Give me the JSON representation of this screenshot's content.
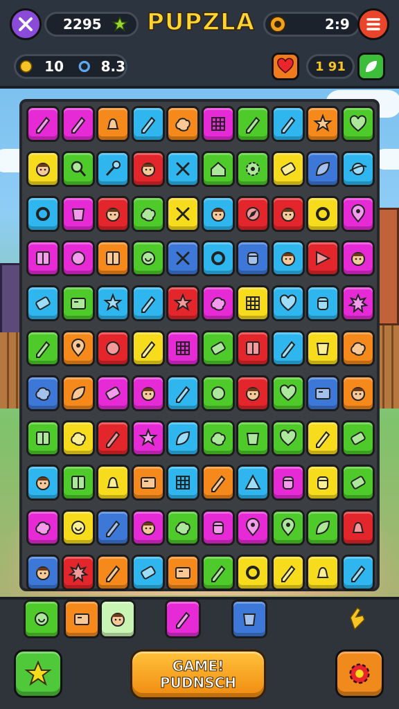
{
  "header": {
    "title": "PUPZLA",
    "score": "2295",
    "timer_value": "2:9",
    "coins": "10",
    "gems": "8.3",
    "energy": "1 91"
  },
  "colors": {
    "magenta": "#e62bd6",
    "orange": "#f5891c",
    "yellow": "#f7dc1e",
    "cyan": "#2fb6ef",
    "green": "#4ecb2a",
    "red": "#e3262b",
    "blue": "#3d78d8",
    "purple": "#a45be6"
  },
  "board": {
    "rows": [
      [
        [
          "magenta",
          "pencil-icon"
        ],
        [
          "magenta",
          "pencil-icon"
        ],
        [
          "orange",
          "bell-icon"
        ],
        [
          "cyan",
          "pencil-icon"
        ],
        [
          "orange",
          "blob-icon"
        ],
        [
          "magenta",
          "grid-icon"
        ],
        [
          "green",
          "pencil-icon"
        ],
        [
          "cyan",
          "pencil-icon"
        ],
        [
          "orange",
          "star-icon"
        ],
        [
          "green",
          "heart-icon"
        ]
      ],
      [
        [
          "yellow",
          "face-icon"
        ],
        [
          "green",
          "magnifier-icon"
        ],
        [
          "cyan",
          "key-icon"
        ],
        [
          "red",
          "face-icon"
        ],
        [
          "cyan",
          "cross-icon"
        ],
        [
          "green",
          "house-icon"
        ],
        [
          "green",
          "gear-icon"
        ],
        [
          "yellow",
          "scroll-icon"
        ],
        [
          "blue",
          "leaf-icon"
        ],
        [
          "cyan",
          "planet-icon"
        ]
      ],
      [
        [
          "cyan",
          "ring-icon"
        ],
        [
          "magenta",
          "cup-icon"
        ],
        [
          "red",
          "face-icon"
        ],
        [
          "green",
          "blob-icon"
        ],
        [
          "yellow",
          "cross-icon"
        ],
        [
          "cyan",
          "face-icon"
        ],
        [
          "red",
          "compass-icon"
        ],
        [
          "red",
          "face-icon"
        ],
        [
          "yellow",
          "ring-icon"
        ],
        [
          "magenta",
          "pin-icon"
        ]
      ],
      [
        [
          "magenta",
          "box-icon"
        ],
        [
          "magenta",
          "circle-icon"
        ],
        [
          "orange",
          "box-icon"
        ],
        [
          "green",
          "shell-icon"
        ],
        [
          "blue",
          "cross-icon"
        ],
        [
          "cyan",
          "ring-icon"
        ],
        [
          "blue",
          "jar-icon"
        ],
        [
          "cyan",
          "face-icon"
        ],
        [
          "red",
          "flag-icon"
        ],
        [
          "magenta",
          "face-icon"
        ]
      ],
      [
        [
          "cyan",
          "scroll-icon"
        ],
        [
          "green",
          "card-icon"
        ],
        [
          "cyan",
          "star-icon"
        ],
        [
          "cyan",
          "pencil-icon"
        ],
        [
          "red",
          "star-icon"
        ],
        [
          "magenta",
          "blob-icon"
        ],
        [
          "yellow",
          "grid-icon"
        ],
        [
          "cyan",
          "heart-icon"
        ],
        [
          "cyan",
          "jar-icon"
        ],
        [
          "magenta",
          "burst-icon"
        ]
      ],
      [
        [
          "green",
          "pencil-icon"
        ],
        [
          "orange",
          "pin-icon"
        ],
        [
          "red",
          "circle-icon"
        ],
        [
          "yellow",
          "pencil-icon"
        ],
        [
          "magenta",
          "grid-icon"
        ],
        [
          "green",
          "scroll-icon"
        ],
        [
          "red",
          "box-icon"
        ],
        [
          "cyan",
          "pencil-icon"
        ],
        [
          "yellow",
          "cup-icon"
        ],
        [
          "orange",
          "blob-icon"
        ]
      ],
      [
        [
          "blue",
          "blob-icon"
        ],
        [
          "orange",
          "leaf-icon"
        ],
        [
          "magenta",
          "scroll-icon"
        ],
        [
          "magenta",
          "face-icon"
        ],
        [
          "cyan",
          "pencil-icon"
        ],
        [
          "green",
          "circle-icon"
        ],
        [
          "red",
          "face-icon"
        ],
        [
          "green",
          "heart-icon"
        ],
        [
          "blue",
          "card-icon"
        ],
        [
          "orange",
          "face-icon"
        ]
      ],
      [
        [
          "green",
          "box-icon"
        ],
        [
          "yellow",
          "blob-icon"
        ],
        [
          "red",
          "pencil-icon"
        ],
        [
          "magenta",
          "star-icon"
        ],
        [
          "cyan",
          "leaf-icon"
        ],
        [
          "green",
          "blob-icon"
        ],
        [
          "green",
          "cup-icon"
        ],
        [
          "green",
          "heart-icon"
        ],
        [
          "yellow",
          "pencil-icon"
        ],
        [
          "green",
          "scroll-icon"
        ]
      ],
      [
        [
          "cyan",
          "face-icon"
        ],
        [
          "green",
          "box-icon"
        ],
        [
          "yellow",
          "bell-icon"
        ],
        [
          "orange",
          "card-icon"
        ],
        [
          "cyan",
          "grid-icon"
        ],
        [
          "orange",
          "pencil-icon"
        ],
        [
          "cyan",
          "triangle-icon"
        ],
        [
          "magenta",
          "jar-icon"
        ],
        [
          "yellow",
          "jar-icon"
        ],
        [
          "green",
          "scroll-icon"
        ]
      ],
      [
        [
          "magenta",
          "blob-icon"
        ],
        [
          "yellow",
          "shell-icon"
        ],
        [
          "blue",
          "pencil-icon"
        ],
        [
          "magenta",
          "face-icon"
        ],
        [
          "green",
          "blob-icon"
        ],
        [
          "magenta",
          "jar-icon"
        ],
        [
          "magenta",
          "pin-icon"
        ],
        [
          "green",
          "pin-icon"
        ],
        [
          "green",
          "leaf-icon"
        ],
        [
          "red",
          "bell-icon"
        ]
      ],
      [
        [
          "blue",
          "face-icon"
        ],
        [
          "red",
          "burst-icon"
        ],
        [
          "orange",
          "pencil-icon"
        ],
        [
          "cyan",
          "scroll-icon"
        ],
        [
          "orange",
          "card-icon"
        ],
        [
          "green",
          "pencil-icon"
        ],
        [
          "yellow",
          "ring-icon"
        ],
        [
          "yellow",
          "pencil-icon"
        ],
        [
          "yellow",
          "bell-icon"
        ],
        [
          "cyan",
          "pencil-icon"
        ]
      ]
    ]
  },
  "tray": {
    "slots": [
      [
        "green",
        "shell-icon"
      ],
      [
        "orange",
        "card-icon"
      ],
      [
        "light",
        "face-icon"
      ],
      [
        "magenta",
        "pencil-icon"
      ],
      [
        "blue",
        "cup-icon"
      ]
    ]
  },
  "buttons": {
    "game_line1": "GAME!",
    "game_line2": "PUDNSCH"
  }
}
